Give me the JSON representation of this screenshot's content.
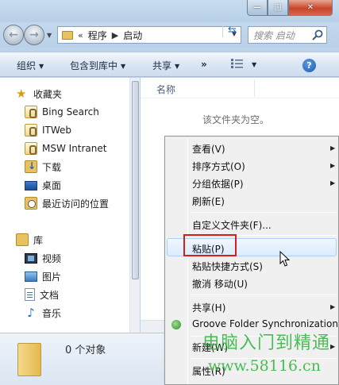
{
  "window": {
    "controls": {
      "minimize": "—",
      "maximize": "□",
      "close": "✕"
    }
  },
  "address_bar": {
    "overflow": "«",
    "crumbs": [
      "程序",
      "启动"
    ],
    "search_placeholder": "搜索 启动"
  },
  "toolbar": {
    "organize": "组织",
    "include_in_library": "包含到库中",
    "share": "共享",
    "more": "»",
    "help": "?"
  },
  "nav": {
    "favorites_header": "收藏夹",
    "favorites": [
      "Bing Search",
      "ITWeb",
      "MSW Intranet",
      "下载",
      "桌面",
      "最近访问的位置"
    ],
    "libraries_header": "库",
    "libraries": [
      "视频",
      "图片",
      "文档",
      "音乐"
    ]
  },
  "content": {
    "column_name": "名称",
    "empty_message": "该文件夹为空。"
  },
  "details": {
    "count": "0 个对象"
  },
  "context_menu": {
    "items": [
      "查看(V)",
      "排序方式(O)",
      "分组依据(P)",
      "刷新(E)",
      "自定义文件夹(F)...",
      "粘贴(P)",
      "粘贴快捷方式(S)",
      "撤消 移动(U)",
      "共享(H)",
      "Groove Folder Synchronization",
      "新建(W)",
      "属性(R)"
    ],
    "highlighted": "粘贴(P)"
  },
  "watermark": {
    "line1": "电脑入门到精通",
    "line2": "www.58116.cn"
  },
  "colors": {
    "accent": "#2a6fc0",
    "highlight_border": "#d62015",
    "watermark": "#2db43a"
  }
}
